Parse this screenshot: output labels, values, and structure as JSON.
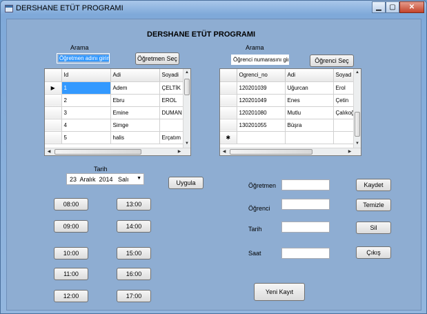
{
  "window": {
    "title": "DERSHANE ETÜT PROGRAMI"
  },
  "main": {
    "heading": "DERSHANE ETÜT PROGRAMI",
    "teacher_search": {
      "label": "Arama",
      "value": "Öğretmen adını girin",
      "button": "Öğretmen Seç"
    },
    "student_search": {
      "label": "Arama",
      "value": "Öğrenci numarasını girin",
      "button": "Öğrenci Seç"
    },
    "teacher_grid": {
      "columns": [
        "Id",
        "Adi",
        "Soyadi"
      ],
      "rows": [
        [
          "1",
          "Adem",
          "ÇELTİK"
        ],
        [
          "2",
          "Ebru",
          "EROL"
        ],
        [
          "3",
          "Emine",
          "DUMAN"
        ],
        [
          "4",
          "Simge",
          ""
        ],
        [
          "5",
          "halis",
          "Erçatım"
        ]
      ],
      "selected_row_marker": "▶"
    },
    "student_grid": {
      "columns": [
        "Ogrenci_no",
        "Adi",
        "Soyad"
      ],
      "rows": [
        [
          "120201039",
          "Uğurcan",
          "Erol"
        ],
        [
          "120201049",
          "Enes",
          "Çetin"
        ],
        [
          "120201080",
          "Mutlu",
          "Çalıkoğ"
        ],
        [
          "130201055",
          "Büşra",
          ""
        ]
      ],
      "new_row_marker": "✱"
    },
    "date": {
      "label": "Tarih",
      "value": "23  Aralık  2014   Salı",
      "apply_button": "Uygula"
    },
    "time_buttons": [
      "08:00",
      "09:00",
      "10:00",
      "11:00",
      "12:00",
      "13:00",
      "14:00",
      "15:00",
      "16:00",
      "17:00"
    ],
    "form": {
      "teacher_label": "Öğretmen",
      "student_label": "Öğrenci",
      "date_label": "Tarih",
      "time_label": "Saat",
      "teacher_value": "",
      "student_value": "",
      "date_value": "",
      "time_value": ""
    },
    "actions": {
      "save": "Kaydet",
      "clear": "Temizle",
      "delete": "Sil",
      "exit": "Çıkış",
      "new_record": "Yeni Kayıt"
    }
  }
}
